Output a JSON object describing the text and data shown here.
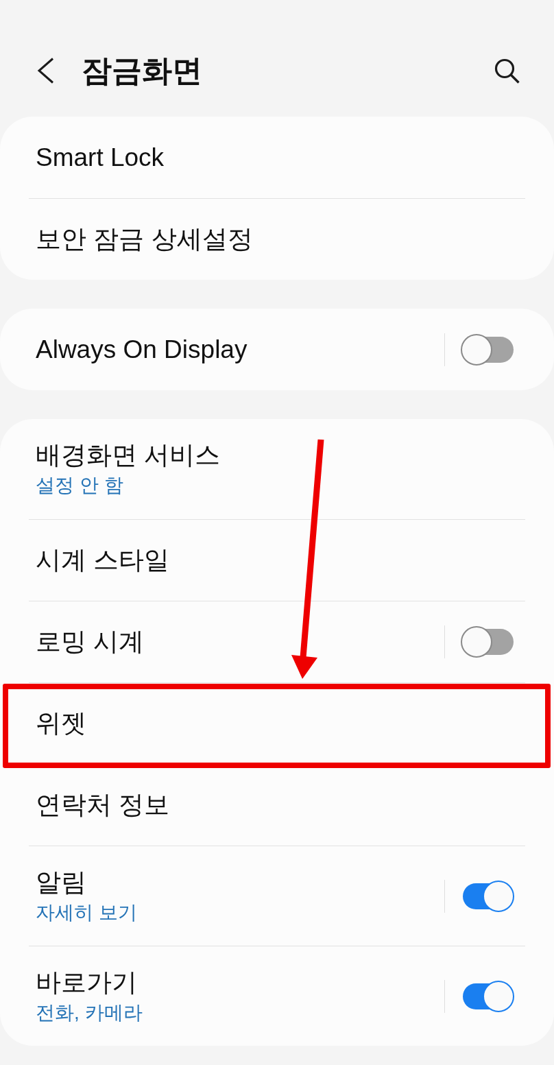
{
  "header": {
    "title": "잠금화면"
  },
  "groups": [
    {
      "items": [
        {
          "kind": "link",
          "title": "Smart Lock",
          "highlighted": false
        },
        {
          "kind": "link",
          "title": "보안 잠금 상세설정",
          "highlighted": false
        }
      ]
    },
    {
      "items": [
        {
          "kind": "switch",
          "title": "Always On Display",
          "on": false,
          "highlighted": false
        }
      ]
    },
    {
      "items": [
        {
          "kind": "link",
          "title": "배경화면 서비스",
          "subtitle": "설정 안 함",
          "highlighted": false
        },
        {
          "kind": "link",
          "title": "시계 스타일",
          "highlighted": false
        },
        {
          "kind": "switch",
          "title": "로밍 시계",
          "on": false,
          "highlighted": false
        },
        {
          "kind": "link",
          "title": "위젯",
          "highlighted": true
        },
        {
          "kind": "link",
          "title": "연락처 정보",
          "highlighted": false
        },
        {
          "kind": "switch",
          "title": "알림",
          "subtitle": "자세히 보기",
          "on": true,
          "highlighted": false
        },
        {
          "kind": "switch",
          "title": "바로가기",
          "subtitle": "전화, 카메라",
          "on": true,
          "highlighted": false
        }
      ]
    }
  ]
}
